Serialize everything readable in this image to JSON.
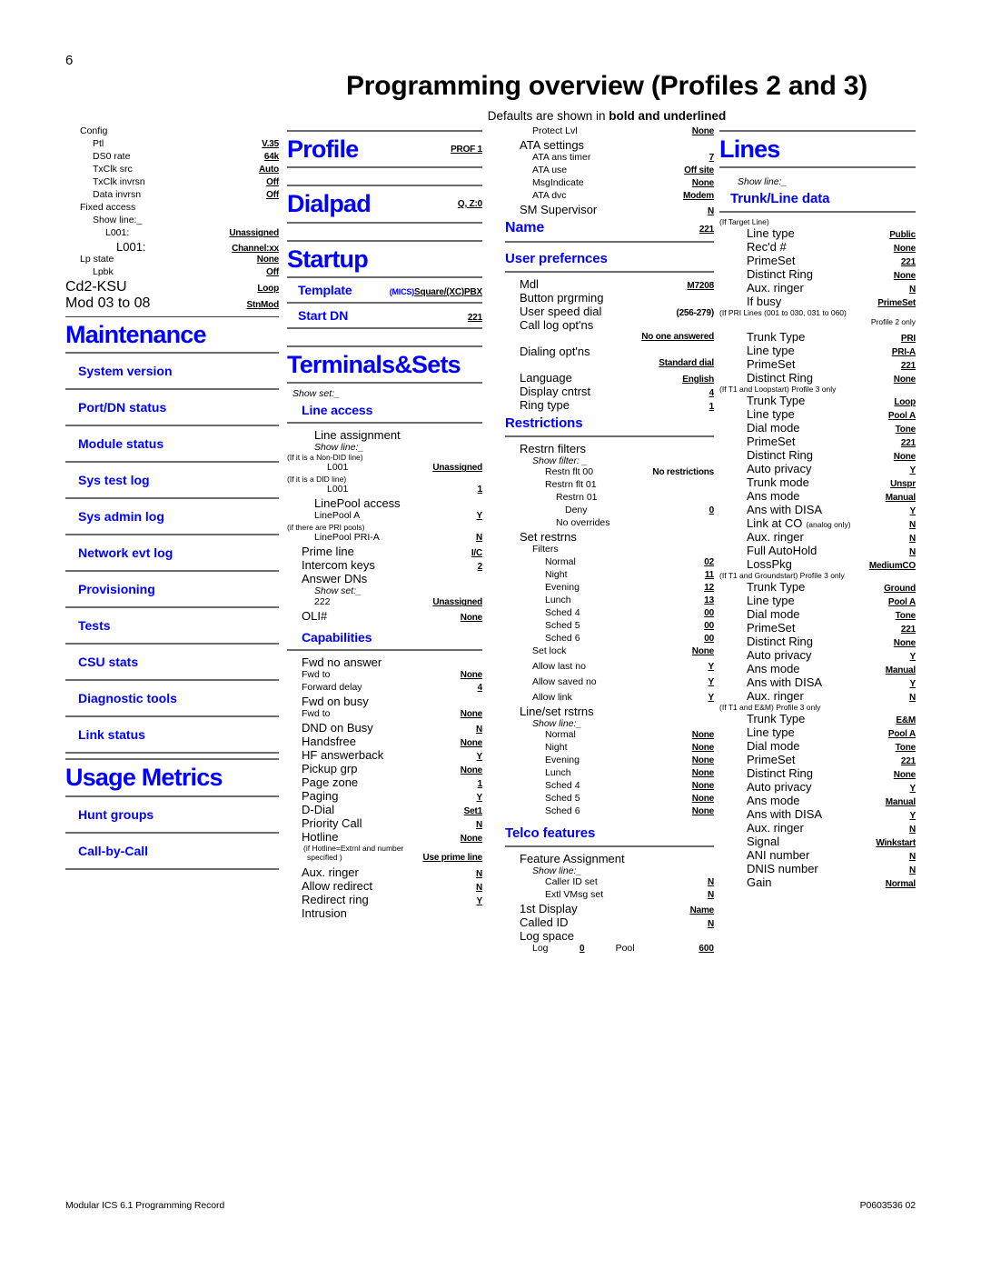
{
  "page": {
    "number": "6",
    "title": "Programming overview (Profiles 2 and 3)",
    "subtitle_pre": "Defaults are shown in ",
    "subtitle_bold": "bold and underlined",
    "footer_left": "Modular ICS 6.1 Programming Record",
    "footer_right": "P0603536  02",
    "accent_color": "#0000ff"
  },
  "col1": {
    "config": {
      "title": "Config",
      "rows": [
        {
          "label": "Ptl",
          "value": "V.35"
        },
        {
          "label": "DS0 rate",
          "value": "64k"
        },
        {
          "label": "TxClk src",
          "value": "Auto"
        },
        {
          "label": "TxClk invrsn",
          "value": "Off"
        },
        {
          "label": "Data invrsn",
          "value": "Off"
        }
      ],
      "fixed_access": "Fixed access",
      "show_line": "Show line:_",
      "l001_a": {
        "label": "L001:",
        "value": "Unassigned"
      },
      "l001_b": {
        "label": "L001:",
        "value": "Channel:xx"
      },
      "lp_state": {
        "label": "Lp state",
        "value": "None"
      },
      "lpbk": {
        "label": "Lpbk",
        "value": "Off"
      },
      "cd2ksu": {
        "label": "Cd2-KSU",
        "value": "Loop"
      },
      "mod": {
        "label": "Mod 03 to 08",
        "value": "StnMod"
      }
    },
    "maintenance": {
      "heading": "Maintenance",
      "items": [
        "System version",
        "Port/DN status",
        "Module status",
        "Sys test log",
        "Sys admin log",
        "Network evt log",
        "Provisioning",
        "Tests",
        "CSU stats",
        "Diagnostic tools",
        "Link status"
      ]
    },
    "usage": {
      "heading": "Usage Metrics",
      "items": [
        "Hunt groups",
        "Call-by-Call"
      ]
    }
  },
  "col2": {
    "profile": {
      "heading": "Profile",
      "value": "PROF 1"
    },
    "dialpad": {
      "heading": "Dialpad",
      "value": "Q, Z:0"
    },
    "startup": {
      "heading": "Startup"
    },
    "template": {
      "label": "Template",
      "value_blue": "(MICS)",
      "value_black": "Square/(XC)PBX"
    },
    "start_dn": {
      "label": "Start DN",
      "value": "221"
    },
    "terminals": {
      "heading": "Terminals&Sets",
      "show_set": "Show set:_",
      "line_access": {
        "heading": "Line access",
        "line_assignment": "Line assignment",
        "show_line": "Show line:_",
        "note_nondid": "(If it is a Non-DID line)",
        "l001_nondid": {
          "label": "L001",
          "value": "Unassigned"
        },
        "note_did": "(If it is a DID line)",
        "l001_did": {
          "label": "L001",
          "value": "1"
        },
        "linepool_access": "LinePool access",
        "linepool_a": {
          "label": "LinePool  A",
          "value": "Y"
        },
        "note_pri": "(if there are PRI pools)",
        "linepool_pri": {
          "label": "LinePool PRI-A",
          "value": "N"
        },
        "prime_line": {
          "label": "Prime line",
          "value": "I/C"
        },
        "intercom_keys": {
          "label": "Intercom keys",
          "value": "2"
        },
        "answer_dns": "Answer DNs",
        "show_set2": "Show set:_",
        "dn222": {
          "label": "222",
          "value": "Unassigned"
        },
        "oli": {
          "label": "OLI#",
          "value": "None"
        }
      },
      "capabilities": {
        "heading": "Capabilities",
        "fwd_no_answer": "Fwd no answer",
        "fwd_to_1": {
          "label": "Fwd to",
          "value": "None"
        },
        "forward_delay": {
          "label": "Forward delay",
          "value": "4"
        },
        "fwd_on_busy": "Fwd on busy",
        "fwd_to_2": {
          "label": "Fwd to",
          "value": "None"
        },
        "rows": [
          {
            "label": "DND on Busy",
            "value": "N"
          },
          {
            "label": "Handsfree",
            "value": "None"
          },
          {
            "label": "HF answerback",
            "value": "Y"
          },
          {
            "label": "Pickup grp",
            "value": "None"
          },
          {
            "label": "Page zone",
            "value": "1"
          },
          {
            "label": "Paging",
            "value": "Y"
          },
          {
            "label": "D-Dial",
            "value": "Set1"
          },
          {
            "label": "Priority Call",
            "value": "N"
          },
          {
            "label": "Hotline",
            "value": "None"
          }
        ],
        "hotline_note_1": "(if Hotline=Extrnl and number",
        "hotline_note_2": "specified )",
        "hotline_note_val": "Use prime line",
        "rows2": [
          {
            "label": "Aux. ringer",
            "value": "N"
          },
          {
            "label": "Allow redirect",
            "value": "N"
          },
          {
            "label": "Redirect ring",
            "value": "Y"
          }
        ],
        "intrusion": "Intrusion"
      }
    }
  },
  "col3": {
    "protect_lvl": {
      "label": "Protect Lvl",
      "value": "None"
    },
    "ata": {
      "title": "ATA settings",
      "rows": [
        {
          "label": "ATA ans timer",
          "value": "7"
        },
        {
          "label": "ATA use",
          "value": "Off site"
        },
        {
          "label": "MsgIndicate",
          "value": "None"
        },
        {
          "label": "ATA dvc",
          "value": "Modem"
        }
      ]
    },
    "sm_supervisor": {
      "label": "SM Supervisor",
      "value": "N"
    },
    "name": {
      "heading": "Name",
      "value": "221"
    },
    "user_prefs": {
      "heading": "User prefernces",
      "mdl": {
        "label": "Mdl",
        "value": "M7208"
      },
      "button_prgrming": "Button prgrming",
      "user_speed_dial": {
        "label": "User speed dial",
        "value": "(256-279)"
      },
      "call_log": "Call log opt'ns",
      "call_log_val": "No one answered",
      "dialing": "Dialing opt'ns",
      "dialing_val": "Standard dial",
      "rows": [
        {
          "label": "Language",
          "value": "English"
        },
        {
          "label": "Display cntrst",
          "value": "4"
        },
        {
          "label": "Ring type",
          "value": "1"
        }
      ]
    },
    "restrictions": {
      "heading": "Restrictions",
      "restrn_filters": "Restrn filters",
      "show_filter": "Show filter: _",
      "flt00": {
        "label": "Restn flt 00",
        "value": "No restrictions"
      },
      "flt01": "Restrn flt 01",
      "restrn01": "Restrn 01",
      "deny": {
        "label": "Deny",
        "value": "0"
      },
      "no_overrides": "No overrides",
      "set_restrns": "Set restrns",
      "filters_label": "Filters",
      "filters": [
        {
          "label": "Normal",
          "value": "02"
        },
        {
          "label": "Night",
          "value": "11"
        },
        {
          "label": "Evening",
          "value": "12"
        },
        {
          "label": "Lunch",
          "value": "13"
        },
        {
          "label": "Sched 4",
          "value": "00"
        },
        {
          "label": "Sched 5",
          "value": "00"
        },
        {
          "label": "Sched 6",
          "value": "00"
        }
      ],
      "set_lock": {
        "label": "Set lock",
        "value": "None"
      },
      "allow": [
        {
          "label": "Allow last no",
          "value": "Y"
        },
        {
          "label": "Allow saved no",
          "value": "Y"
        },
        {
          "label": "Allow link",
          "value": "Y"
        }
      ],
      "line_set_rstrns": "Line/set rstrns",
      "show_line": "Show line:_",
      "line_filters": [
        {
          "label": "Normal",
          "value": "None"
        },
        {
          "label": "Night",
          "value": "None"
        },
        {
          "label": "Evening",
          "value": "None"
        },
        {
          "label": "Lunch",
          "value": "None"
        },
        {
          "label": "Sched 4",
          "value": "None"
        },
        {
          "label": "Sched 5",
          "value": "None"
        },
        {
          "label": "Sched 6",
          "value": "None"
        }
      ]
    },
    "telco": {
      "heading": "Telco features",
      "feature_assignment": "Feature Assignment",
      "show_line": "Show line:_",
      "caller_id": {
        "label": "Caller ID set",
        "value": "N"
      },
      "extl_vmsg": {
        "label": "Extl VMsg set",
        "value": "N"
      },
      "first_display": {
        "label": "1st Display",
        "value": "Name"
      },
      "called_id": {
        "label": "Called ID",
        "value": "N"
      },
      "log_space": "Log space",
      "log": {
        "l1": "Log",
        "v1": "0",
        "l2": "Pool",
        "v2": "600"
      }
    }
  },
  "col4": {
    "heading": "Lines",
    "show_line": "Show line:_",
    "trunk_line_data": "Trunk/Line data",
    "target": {
      "note": "(If Target Line)",
      "rows": [
        {
          "label": "Line type",
          "value": "Public"
        },
        {
          "label": "Rec'd #",
          "value": "None"
        },
        {
          "label": "PrimeSet",
          "value": "221"
        },
        {
          "label": "Distinct Ring",
          "value": "None"
        },
        {
          "label": "Aux. ringer",
          "value": "N"
        },
        {
          "label": "If busy",
          "value": "PrimeSet"
        }
      ]
    },
    "pri": {
      "note": "(If PRI Lines (001 to 030, 031 to 060)",
      "note2": "Profile 2 only",
      "rows": [
        {
          "label": "Trunk Type",
          "value": "PRI"
        },
        {
          "label": "Line type",
          "value": "PRI-A"
        },
        {
          "label": "PrimeSet",
          "value": "221"
        },
        {
          "label": "Distinct Ring",
          "value": "None"
        }
      ]
    },
    "loopstart": {
      "note": "(If T1 and Loopstart) Profile 3 only",
      "rows": [
        {
          "label": "Trunk Type",
          "value": "Loop"
        },
        {
          "label": "Line type",
          "value": "Pool A"
        },
        {
          "label": "Dial mode",
          "value": "Tone"
        },
        {
          "label": "PrimeSet",
          "value": "221"
        },
        {
          "label": "Distinct Ring",
          "value": "None"
        },
        {
          "label": "Auto privacy",
          "value": "Y"
        },
        {
          "label": "Trunk mode",
          "value": "Unspr"
        },
        {
          "label": "Ans mode",
          "value": "Manual"
        },
        {
          "label": "Ans with DISA",
          "value": "Y"
        }
      ],
      "link_at_co": {
        "label": "Link at CO",
        "note": "(analog only)",
        "value": "N"
      },
      "rows2": [
        {
          "label": "Aux. ringer",
          "value": "N"
        },
        {
          "label": "Full AutoHold",
          "value": "N"
        },
        {
          "label": "LossPkg",
          "value": "MediumCO"
        }
      ]
    },
    "groundstart": {
      "note": "(If T1 and Groundstart) Profile 3 only",
      "rows": [
        {
          "label": "Trunk Type",
          "value": "Ground"
        },
        {
          "label": "Line type",
          "value": "Pool A"
        },
        {
          "label": "Dial mode",
          "value": "Tone"
        },
        {
          "label": "PrimeSet",
          "value": "221"
        },
        {
          "label": "Distinct Ring",
          "value": "None"
        },
        {
          "label": "Auto privacy",
          "value": "Y"
        },
        {
          "label": "Ans mode",
          "value": "Manual"
        },
        {
          "label": "Ans with DISA",
          "value": "Y"
        },
        {
          "label": "Aux. ringer",
          "value": "N"
        }
      ]
    },
    "em": {
      "note": "(If T1 and E&M) Profile 3 only",
      "rows": [
        {
          "label": "Trunk Type",
          "value": "E&M"
        },
        {
          "label": "Line type",
          "value": "Pool A"
        },
        {
          "label": "Dial mode",
          "value": "Tone"
        },
        {
          "label": "PrimeSet",
          "value": "221"
        },
        {
          "label": "Distinct Ring",
          "value": "None"
        },
        {
          "label": "Auto privacy",
          "value": "Y"
        },
        {
          "label": "Ans mode",
          "value": "Manual"
        },
        {
          "label": "Ans with DISA",
          "value": "Y"
        },
        {
          "label": "Aux. ringer",
          "value": "N"
        },
        {
          "label": "Signal",
          "value": "Winkstart"
        },
        {
          "label": "ANI number",
          "value": "N"
        },
        {
          "label": "DNIS number",
          "value": "N"
        },
        {
          "label": "Gain",
          "value": "Normal"
        }
      ]
    }
  }
}
